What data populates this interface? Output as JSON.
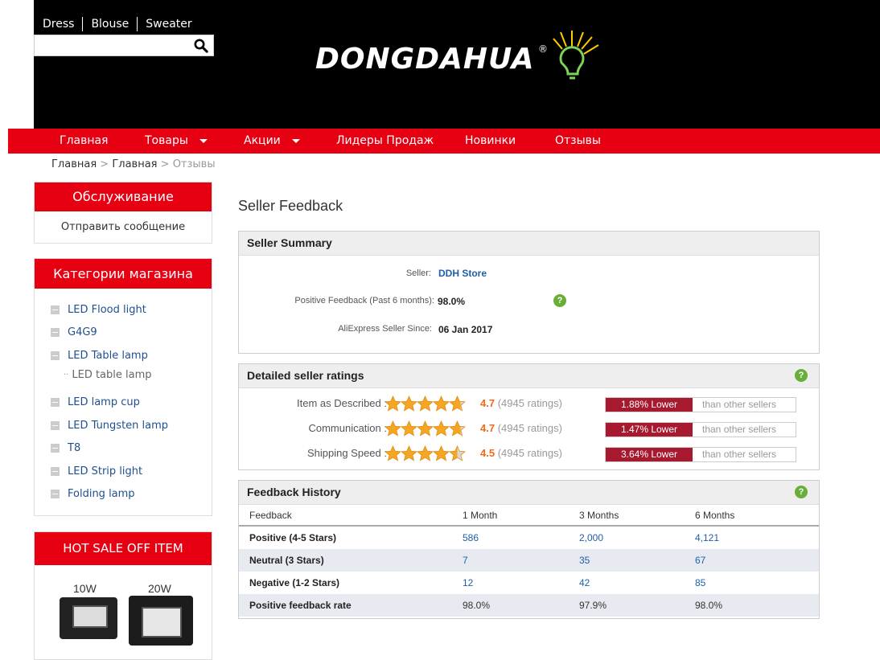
{
  "header": {
    "quicklinks": [
      "Dress",
      "Blouse",
      "Sweater"
    ],
    "search": {
      "placeholder": "",
      "button_icon": "search-icon"
    },
    "logo_text": "DONGDAHUA",
    "logo_mark": "®"
  },
  "nav": {
    "items": [
      {
        "label": "Главная",
        "dropdown": false
      },
      {
        "label": "Товары",
        "dropdown": true
      },
      {
        "label": "Акции",
        "dropdown": true
      },
      {
        "label": "Лидеры Продаж",
        "dropdown": false
      },
      {
        "label": "Новинки",
        "dropdown": false
      },
      {
        "label": "Отзывы",
        "dropdown": false
      }
    ]
  },
  "breadcrumb": {
    "items": [
      "Главная",
      "Главная",
      "Отзывы"
    ],
    "separator": ">"
  },
  "sidebar": {
    "service": {
      "title": "Обслуживание",
      "link": "Отправить сообщение"
    },
    "categories": {
      "title": "Категории магазина",
      "items": [
        {
          "label": "LED Flood light"
        },
        {
          "label": "G4G9"
        },
        {
          "label": "LED Table lamp"
        },
        {
          "label": "LED table lamp"
        },
        {
          "label": "LED lamp cup"
        },
        {
          "label": "LED Tungsten lamp"
        },
        {
          "label": "T8"
        },
        {
          "label": "LED Strip light"
        },
        {
          "label": "Folding lamp"
        }
      ]
    },
    "hot_sale": {
      "title": "HOT SALE OFF ITEM",
      "labels": [
        "10W",
        "20W"
      ]
    }
  },
  "main": {
    "title": "Seller Feedback",
    "summary": {
      "title": "Seller Summary",
      "seller_label": "Seller:",
      "seller_name": "DDH Store",
      "positive_label": "Positive Feedback (Past 6 months):",
      "positive_value": "98.0%",
      "since_label": "AliExpress Seller Since:",
      "since_value": "06 Jan 2017"
    },
    "ratings": {
      "title": "Detailed seller ratings",
      "items": [
        {
          "label": "Item as Described :",
          "stars": 4.7,
          "score": "4.7",
          "count": "(4945 ratings)",
          "cmp": "1.88% Lower",
          "than": "than other sellers"
        },
        {
          "label": "Communication :",
          "stars": 4.7,
          "score": "4.7",
          "count": "(4945 ratings)",
          "cmp": "1.47% Lower",
          "than": "than other sellers"
        },
        {
          "label": "Shipping Speed :",
          "stars": 4.5,
          "score": "4.5",
          "count": "(4945 ratings)",
          "cmp": "3.64% Lower",
          "than": "than other sellers"
        }
      ]
    },
    "history": {
      "title": "Feedback History",
      "columns": [
        "Feedback",
        "1 Month",
        "3 Months",
        "6 Months"
      ],
      "rows": [
        {
          "label": "Positive (4-5 Stars)",
          "values": [
            "586",
            "2,000",
            "4,121"
          ]
        },
        {
          "label": "Neutral (3 Stars)",
          "values": [
            "7",
            "35",
            "67"
          ]
        },
        {
          "label": "Negative (1-2 Stars)",
          "values": [
            "12",
            "42",
            "85"
          ]
        },
        {
          "label": "Positive feedback rate",
          "values": [
            "98.0%",
            "97.9%",
            "98.0%"
          ]
        }
      ]
    }
  },
  "colors": {
    "accent": "#e60012",
    "link": "#1f5fa8",
    "star": "#f5a623",
    "score": "#f06a1b",
    "compare": "#a6192e"
  }
}
